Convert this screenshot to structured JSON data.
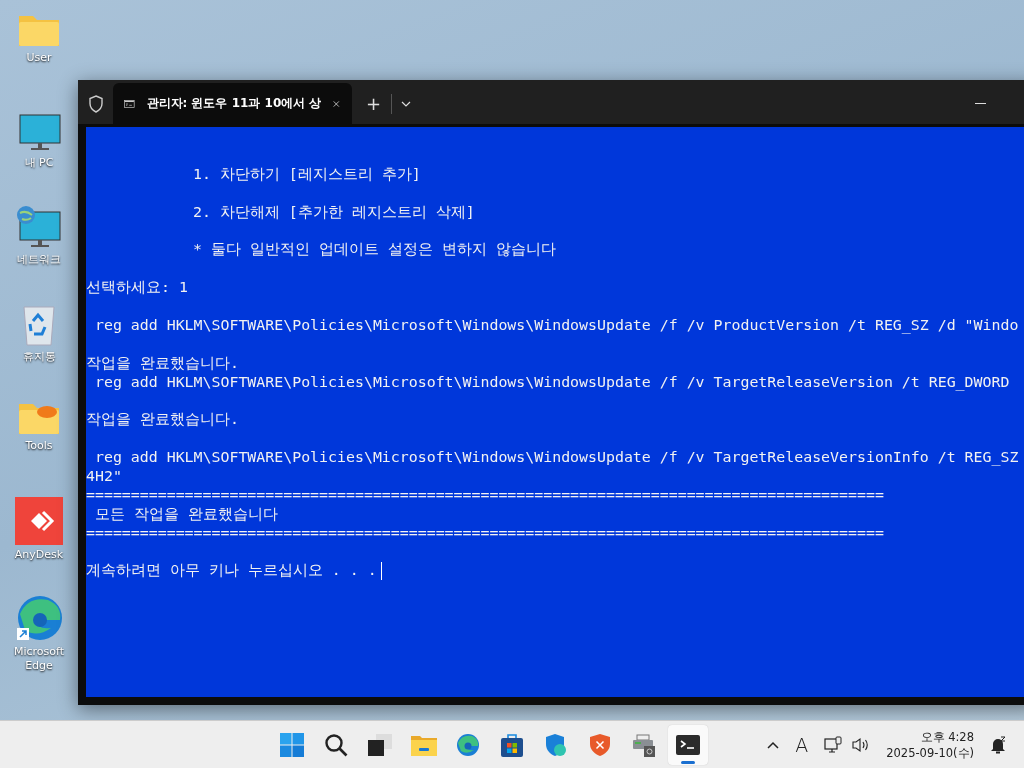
{
  "desktop_icons": [
    {
      "label": "User",
      "kind": "folder"
    },
    {
      "label": "내 PC",
      "kind": "monitor"
    },
    {
      "label": "네트워크",
      "kind": "network"
    },
    {
      "label": "휴지통",
      "kind": "recycle"
    },
    {
      "label": "Tools",
      "kind": "tools"
    },
    {
      "label": "AnyDesk",
      "kind": "anydesk"
    },
    {
      "label": "Microsoft Edge",
      "kind": "edge"
    }
  ],
  "window": {
    "tab_title": "관리자: 윈도우 11과 10에서 상",
    "new_tab": "+",
    "console_lines": [
      {
        "kind": "blank"
      },
      {
        "kind": "blank"
      },
      {
        "kind": "item",
        "text": "1. 차단하기 [레지스트리 추가]"
      },
      {
        "kind": "blank"
      },
      {
        "kind": "item",
        "text": "2. 차단해제 [추가한 레지스트리 삭제]"
      },
      {
        "kind": "blank"
      },
      {
        "kind": "item",
        "text": "* 둘다 일반적인 업데이트 설정은 변하지 않습니다"
      },
      {
        "kind": "blank"
      },
      {
        "kind": "text",
        "text": "선택하세요: 1"
      },
      {
        "kind": "blank"
      },
      {
        "kind": "text",
        "text": " reg add HKLM\\SOFTWARE\\Policies\\Microsoft\\Windows\\WindowsUpdate /f /v ProductVersion /t REG_SZ /d \"Windo"
      },
      {
        "kind": "blank"
      },
      {
        "kind": "text",
        "text": "작업을 완료했습니다."
      },
      {
        "kind": "text",
        "text": " reg add HKLM\\SOFTWARE\\Policies\\Microsoft\\Windows\\WindowsUpdate /f /v TargetReleaseVersion /t REG_DWORD"
      },
      {
        "kind": "blank"
      },
      {
        "kind": "text",
        "text": "작업을 완료했습니다."
      },
      {
        "kind": "blank"
      },
      {
        "kind": "text",
        "text": " reg add HKLM\\SOFTWARE\\Policies\\Microsoft\\Windows\\WindowsUpdate /f /v TargetReleaseVersionInfo /t REG_SZ"
      },
      {
        "kind": "text",
        "text": "4H2\""
      },
      {
        "kind": "text",
        "text": "========================================================================================="
      },
      {
        "kind": "text",
        "text": " 모든 작업을 완료했습니다"
      },
      {
        "kind": "text",
        "text": "========================================================================================="
      },
      {
        "kind": "blank"
      },
      {
        "kind": "prompt",
        "text": "계속하려면 아무 키나 누르십시오 . . .",
        "cursor": true
      }
    ]
  },
  "taskbar": {
    "apps": [
      {
        "kind": "start",
        "active": false
      },
      {
        "kind": "search",
        "active": false
      },
      {
        "kind": "taskview",
        "active": false
      },
      {
        "kind": "explorer",
        "active": false
      },
      {
        "kind": "edge",
        "active": false
      },
      {
        "kind": "store",
        "active": false
      },
      {
        "kind": "defender",
        "active": false
      },
      {
        "kind": "shieldx",
        "active": false
      },
      {
        "kind": "printer",
        "active": false
      },
      {
        "kind": "terminal",
        "active": true
      }
    ],
    "tray_input": "A",
    "clock": {
      "time": "오후 4:28",
      "date": "2025-09-10(수)"
    }
  }
}
